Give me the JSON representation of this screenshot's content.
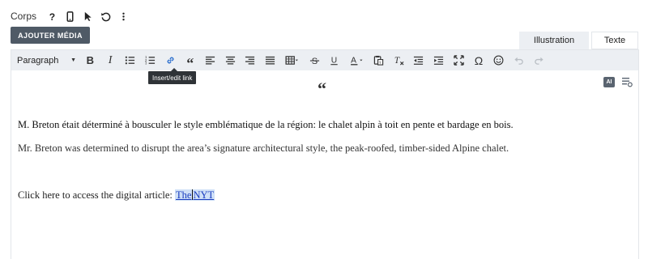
{
  "header": {
    "label": "Corps",
    "icons": [
      "help-icon",
      "mobile-icon",
      "cursor-icon",
      "undo-circle-icon",
      "more-vertical-icon"
    ]
  },
  "media_button": "AJOUTER MÉDIA",
  "tabs": [
    {
      "label": "Illustration",
      "active": true
    },
    {
      "label": "Texte",
      "active": false
    }
  ],
  "toolbar": {
    "format_select": "Paragraph",
    "tooltip": "Insert/edit link",
    "active_tool": "link-icon",
    "disabled_tools": [
      "undo-icon",
      "redo-icon"
    ]
  },
  "editor": {
    "quote_mark": "“",
    "ai_badge": "AI",
    "paragraph_fr": "M. Breton était déterminé à bousculer le style emblématique de la région: le chalet alpin à toit en pente et bardage en bois.",
    "paragraph_en": "Mr. Breton was determined to disrupt the area’s signature architectural style, the peak-roofed, timber-sided Alpine chalet.",
    "link_prefix": "Click here to access the digital article:",
    "link_text_a": "The",
    "link_text_b": "NYT"
  },
  "colors": {
    "toolbar_bg": "#eceff3",
    "button_bg": "#4f5a66",
    "link": "#1a3dbf",
    "link_highlight": "#cfe0f7",
    "active_icon": "#2c6fce"
  }
}
